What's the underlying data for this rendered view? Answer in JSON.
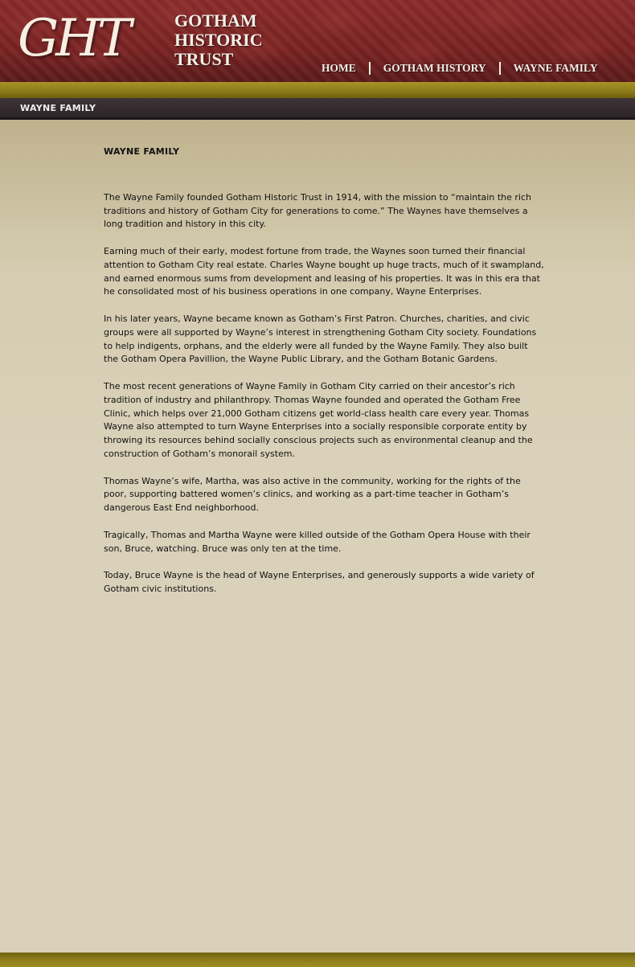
{
  "header": {
    "logo_mark": "GHT",
    "logo_lines": [
      "GOTHAM",
      "HISTORIC",
      "TRUST"
    ],
    "nav": [
      "HOME",
      "GOTHAM HISTORY",
      "WAYNE FAMILY"
    ]
  },
  "section_bar": {
    "label": "WAYNE FAMILY"
  },
  "main": {
    "heading": "WAYNE FAMILY",
    "paragraphs": [
      "The Wayne Family founded Gotham Historic Trust in 1914, with the mission to “maintain the rich traditions and history of Gotham City for generations to come.” The Waynes have themselves a long tradition and history in this city.",
      "Earning much of their early, modest fortune from trade, the Waynes soon turned their financial attention to Gotham City real estate. Charles Wayne bought up huge tracts, much of it swampland, and earned enormous sums from development and leasing of his properties. It was in this era that he consolidated most of his business operations in one company, Wayne Enterprises.",
      "In his later years, Wayne became known as Gotham’s First Patron. Churches, charities, and civic groups were all supported by Wayne’s interest in strengthening Gotham City society. Foundations to help indigents, orphans, and the elderly were all funded by the Wayne Family. They also built the Gotham Opera Pavillion, the Wayne Public Library, and the Gotham Botanic Gardens.",
      "The most recent generations of Wayne Family in Gotham City carried on their ancestor’s rich tradition of industry and philanthropy. Thomas Wayne founded and operated the Gotham Free Clinic, which helps over 21,000 Gotham citizens get world-class health care every year. Thomas Wayne also attempted to turn Wayne Enterprises into a socially responsible corporate entity by throwing its resources behind socially conscious projects such as environmental cleanup and the construction of Gotham’s monorail system.",
      "Thomas Wayne’s wife, Martha, was also active in the community, working for the rights of the poor, supporting battered women’s clinics, and working as a part-time teacher in Gotham’s dangerous East End neighborhood.",
      "Tragically, Thomas and Martha Wayne were killed outside of the Gotham Opera House with their son, Bruce, watching. Bruce was only ten at the time.",
      "Today, Bruce Wayne is the head of Wayne Enterprises, and generously supports a wide variety of Gotham civic institutions."
    ]
  },
  "colors": {
    "header_red": "#7a2222",
    "gold_bar": "#8b7a18",
    "section_bar": "#3e3439",
    "page_bg": "#d9d1b9"
  }
}
